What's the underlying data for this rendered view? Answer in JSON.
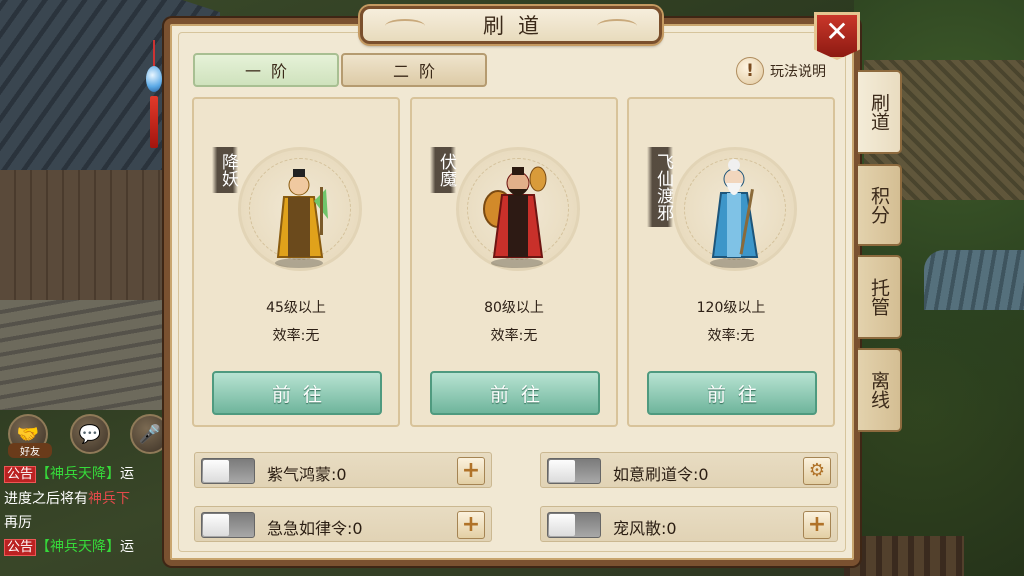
{
  "panel": {
    "title": "刷道",
    "tiers": [
      "一阶",
      "二阶"
    ],
    "help_label": "玩法说明",
    "close_symbol": "✕"
  },
  "cards": [
    {
      "name": "降妖",
      "level": "45级以上",
      "efficiency": "效率:无",
      "button": "前往",
      "robe": "#e0a21b",
      "robe_dark": "#8a5c10"
    },
    {
      "name": "伏魔",
      "level": "80级以上",
      "efficiency": "效率:无",
      "button": "前往",
      "robe": "#c9302a",
      "robe_dark": "#6e1512"
    },
    {
      "name": "飞仙渡邪",
      "level": "120级以上",
      "efficiency": "效率:无",
      "button": "前往",
      "robe": "#3d96c9",
      "robe_dark": "#1d557a"
    }
  ],
  "items": [
    {
      "label": "紫气鸿蒙:0",
      "action": "+",
      "action_icon": "plus-icon"
    },
    {
      "label": "如意刷道令:0",
      "action": "⚙",
      "action_icon": "gear-icon"
    },
    {
      "label": "急急如律令:0",
      "action": "+",
      "action_icon": "plus-icon"
    },
    {
      "label": "宠风散:0",
      "action": "+",
      "action_icon": "plus-icon"
    }
  ],
  "side_tabs": [
    {
      "label": "刷道",
      "active": true
    },
    {
      "label": "积分",
      "active": false
    },
    {
      "label": "托管",
      "active": false
    },
    {
      "label": "离线",
      "active": false
    }
  ],
  "hud": {
    "friend_label": "好友",
    "chat": [
      {
        "tag": "公告",
        "highlight": "【神兵天降】",
        "text": "运"
      },
      {
        "text": "进度之后将有",
        "red": "神兵下"
      },
      {
        "text": "再厉"
      },
      {
        "tag": "公告",
        "highlight": "【神兵天降】",
        "text": "运"
      }
    ]
  },
  "colors": {
    "panel_bg": "#f1e8d3",
    "frame": "#7a5130",
    "go_button": "#6fb59c",
    "close_button": "#c9372a"
  }
}
